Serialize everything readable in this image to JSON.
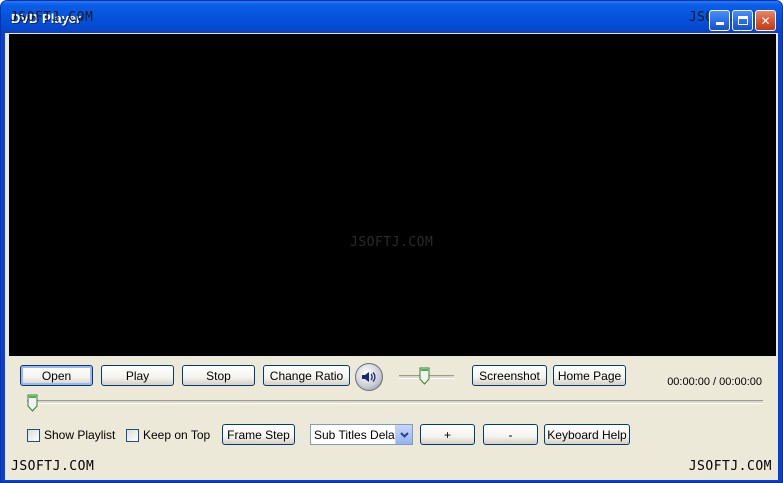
{
  "window": {
    "title": "DVD Player",
    "watermark": "JSOFTJ.COM"
  },
  "controls": {
    "open_label": "Open",
    "play_label": "Play",
    "stop_label": "Stop",
    "change_ratio_label": "Change Ratio",
    "screenshot_label": "Screenshot",
    "home_page_label": "Home Page",
    "time": "00:00:00 / 00:00:00",
    "volume_level": 0.45,
    "seek_position": 0.0
  },
  "options": {
    "show_playlist_label": "Show Playlist",
    "show_playlist_checked": false,
    "keep_on_top_label": "Keep on Top",
    "keep_on_top_checked": false,
    "frame_step_label": "Frame Step",
    "subtitles_delay_value": "Sub Titles Delay",
    "plus_label": "+",
    "minus_label": "-",
    "keyboard_help_label": "Keyboard Help"
  },
  "colors": {
    "titlebar": "#0553dd",
    "client_bg": "#ece9d8",
    "video_bg": "#000000"
  }
}
